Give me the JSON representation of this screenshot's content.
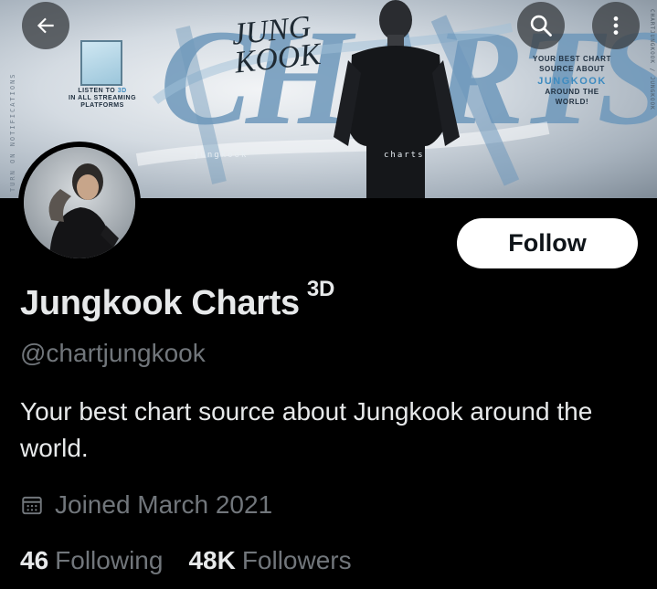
{
  "banner": {
    "vertical_left": "TURN ON NOTIFICATIONS",
    "vertical_right": "CHARTJUNGKOOK / JUNGKOOK",
    "big_word": "CHARTS",
    "name_word": "JUNG\nKOOK",
    "promo_left_line1": "LISTEN TO",
    "promo_left_highlight": "3D",
    "promo_left_line2": "IN ALL STREAMING",
    "promo_left_line3": "PLATFORMS",
    "promo_right_line1": "YOUR BEST CHART",
    "promo_right_line2": "SOURCE ABOUT",
    "promo_right_accent": "JUNGKOOK",
    "promo_right_line3": "AROUND THE",
    "promo_right_line4": "WORLD!",
    "tag_left": "jungkook",
    "tag_right": "charts"
  },
  "nav": {
    "back_icon": "arrow-left-icon",
    "search_icon": "search-icon",
    "more_icon": "more-vertical-icon"
  },
  "profile": {
    "follow_label": "Follow",
    "display_name": "Jungkook Charts",
    "name_suffix": "3D",
    "handle": "@chartjungkook",
    "bio": "Your best chart source about Jungkook around the world.",
    "joined": "Joined March 2021",
    "following_count": "46",
    "following_label": "Following",
    "followers_count": "48K",
    "followers_label": "Followers"
  },
  "colors": {
    "background": "#000000",
    "text_primary": "#e7e9ea",
    "text_secondary": "#71767b",
    "follow_bg": "#ffffff",
    "banner_accent": "#3d8bc0"
  }
}
